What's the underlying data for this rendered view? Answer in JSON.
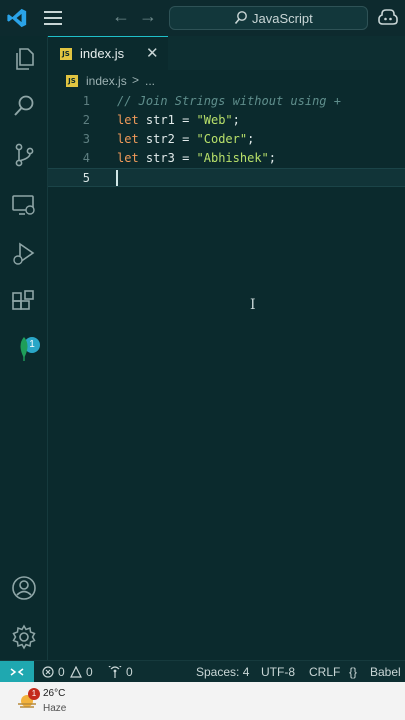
{
  "titlebar": {
    "search_text": "JavaScript",
    "icons": [
      "vscode-logo-icon",
      "menu-icon",
      "arrow-left-icon",
      "arrow-right-icon",
      "search-icon",
      "copilot-icon"
    ]
  },
  "activity": {
    "icons": [
      "files-icon",
      "search-icon",
      "source-control-icon",
      "remote-explorer-icon",
      "run-debug-icon",
      "extensions-icon",
      "mongodb-leaf-icon",
      "account-icon",
      "settings-gear-icon"
    ],
    "extensions_badge": "1"
  },
  "tab": {
    "icon_text": "JS",
    "label": "index.js",
    "close_glyph": "✕"
  },
  "breadcrumb": {
    "file": "index.js",
    "separator": ">",
    "more": "..."
  },
  "editor": {
    "lines": [
      {
        "num": "1",
        "comment": "// Join Strings without using +"
      },
      {
        "num": "2",
        "kw": "let",
        "var": "str1",
        "op": "=",
        "str": "\"Web\"",
        "end": ";"
      },
      {
        "num": "3",
        "kw": "let",
        "var": "str2",
        "op": "=",
        "str": "\"Coder\"",
        "end": ";"
      },
      {
        "num": "4",
        "kw": "let",
        "var": "str3",
        "op": "=",
        "str": "\"Abhishek\"",
        "end": ";"
      },
      {
        "num": "5"
      }
    ],
    "cursor_glyph": "I"
  },
  "status": {
    "errors": "0",
    "warnings": "0",
    "ports": "0",
    "spaces": "Spaces: 4",
    "encoding": "UTF-8",
    "eol": "CRLF",
    "language": "Babel ..."
  },
  "taskbar": {
    "temperature": "26°C",
    "condition": "Haze",
    "badge": "1"
  },
  "colors": {
    "background": "#0b2a2d",
    "accent": "#1fc0c9",
    "keyword": "#f09a5a",
    "string": "#b8e06a",
    "comment": "#5f8e8c"
  }
}
